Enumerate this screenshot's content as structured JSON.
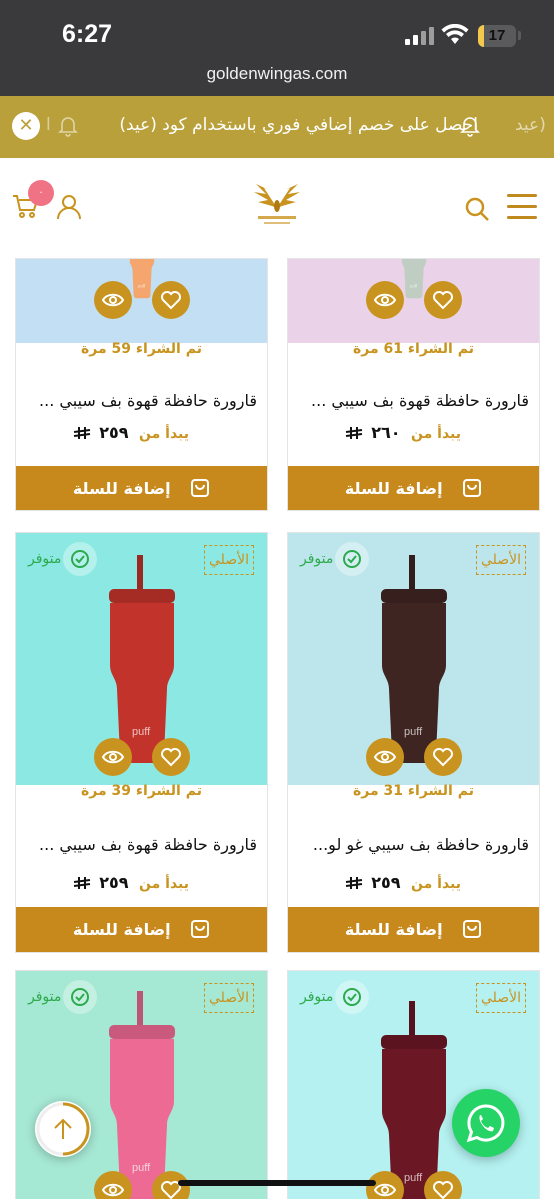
{
  "status_bar": {
    "time": "6:27",
    "battery": "17",
    "battery_level": 0.17,
    "url": "goldenwingas.com"
  },
  "promo": {
    "text": "احصل على خصم إضافي فوري باستخدام كود (عيد)",
    "tail_text": "(عيد",
    "faded_head": "ا",
    "color": "#b9a03a"
  },
  "header": {
    "cart_count": "٠",
    "logo_icon": "golden-wings-logo",
    "accent": "#c8941f"
  },
  "products": [
    {
      "name": "قارورة حافظة قهوة بف سيبي ...",
      "purchased": "تم الشراء 61 مرة",
      "price_from": "يبدأ من",
      "price": "٢٦٠",
      "add_label": "إضافة للسلة",
      "bg": "#ead2e8",
      "cup": "#bfcdc3",
      "original": "",
      "available": ""
    },
    {
      "name": "قارورة حافظة قهوة بف سيبي ...",
      "purchased": "تم الشراء 59 مرة",
      "price_from": "يبدأ من",
      "price": "٢٥٩",
      "add_label": "إضافة للسلة",
      "bg": "#c3dff3",
      "cup": "#f4a66e",
      "original": "",
      "available": ""
    },
    {
      "name": "قارورة حافظة بف سيبي غو لو...",
      "purchased": "تم الشراء 31 مرة",
      "price_from": "يبدأ من",
      "price": "٢٥٩",
      "add_label": "إضافة للسلة",
      "bg": "#bde6ec",
      "cup": "#3f2522",
      "original": "الأصلي",
      "available": "متوفر"
    },
    {
      "name": "قارورة حافظة قهوة بف سيبي ...",
      "purchased": "تم الشراء 39 مرة",
      "price_from": "يبدأ من",
      "price": "٢٥٩",
      "add_label": "إضافة للسلة",
      "bg": "#8ce8e2",
      "cup": "#c2332b",
      "original": "الأصلي",
      "available": "متوفر"
    },
    {
      "name": "",
      "purchased": "",
      "price_from": "",
      "price": "",
      "add_label": "",
      "bg": "#b4f1f0",
      "cup": "#6b1824",
      "original": "الأصلي",
      "available": "متوفر"
    },
    {
      "name": "",
      "purchased": "",
      "price_from": "",
      "price": "",
      "add_label": "",
      "bg": "#a5e8d3",
      "cup": "#ec6a93",
      "original": "الأصلي",
      "available": "متوفر"
    }
  ],
  "icons": {
    "cup_brand": "puff",
    "currency": "riyal-sign",
    "scroll_top": "arrow-up-icon",
    "whatsapp": "whatsapp-icon"
  }
}
